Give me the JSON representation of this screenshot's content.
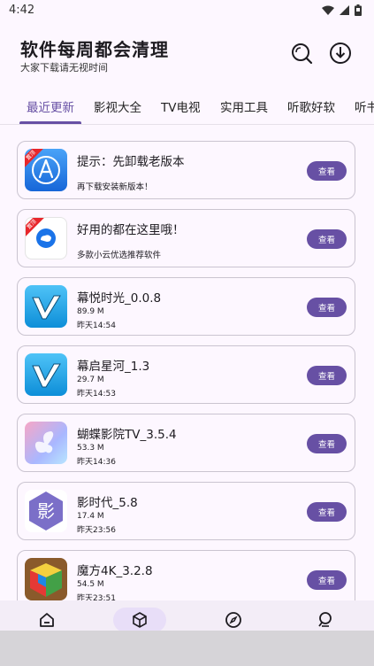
{
  "status": {
    "time": "4:42"
  },
  "header": {
    "title": "软件每周都会清理",
    "subtitle": "大家下载请无视时间"
  },
  "tabs": [
    {
      "label": "最近更新"
    },
    {
      "label": "影视大全"
    },
    {
      "label": "TV电视"
    },
    {
      "label": "实用工具"
    },
    {
      "label": "听歌好软"
    },
    {
      "label": "听书"
    }
  ],
  "items": [
    {
      "name": "提示：先卸载老版本",
      "desc": "再下载安装新版本！",
      "badge": "置顶",
      "button": "查看"
    },
    {
      "name": "好用的都在这里哦！",
      "desc": "多款小云优选推荐软件",
      "badge": "置顶",
      "button": "查看"
    },
    {
      "name": "幕悦时光_0.0.8",
      "size": "89.9 M",
      "date": "昨天14:54",
      "button": "查看"
    },
    {
      "name": "幕启星河_1.3",
      "size": "29.7 M",
      "date": "昨天14:53",
      "button": "查看"
    },
    {
      "name": "蝴蝶影院TV_3.5.4",
      "size": "53.3 M",
      "date": "昨天14:36",
      "button": "查看"
    },
    {
      "name": "影时代_5.8",
      "size": "17.4 M",
      "date": "昨天23:56",
      "icon_char": "影",
      "button": "查看"
    },
    {
      "name": "魔方4K_3.2.8",
      "size": "54.5 M",
      "date": "昨天23:51",
      "button": "查看"
    }
  ],
  "colors": {
    "accent": "#6750a4",
    "badge": "#e8262b",
    "background": "#fdf7ff"
  }
}
